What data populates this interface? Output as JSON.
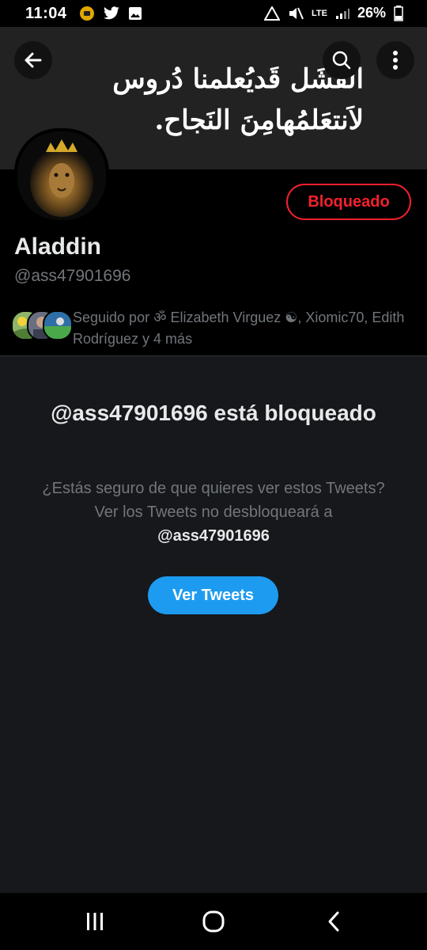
{
  "status_bar": {
    "time": "11:04",
    "network": "LTE",
    "battery": "26%"
  },
  "header": {
    "back_icon": "arrow-left-icon",
    "search_icon": "search-icon",
    "more_icon": "more-vertical-icon",
    "banner_text_line1": "الفَشَل قَديُعلمنا دُروس",
    "banner_text_line2": "لاَنتعَلمُهامِنَ النَجاح."
  },
  "profile": {
    "name": "Aladdin",
    "handle": "@ass47901696",
    "blocked_label": "Bloqueado",
    "followed_by": "Seguido por ॐ Elizabeth Virguez ☯, Xiomic70, Edith Rodríguez y 4 más"
  },
  "blocked_notice": {
    "title": "@ass47901696 está bloqueado",
    "description": "¿Estás seguro de que quieres ver estos Tweets? Ver los Tweets no desbloqueará a",
    "description_handle": "@ass47901696",
    "button_label": "Ver Tweets"
  },
  "colors": {
    "accent": "#1d9bf0",
    "danger": "#f4212e",
    "background": "#000000",
    "panel": "#16181c"
  }
}
